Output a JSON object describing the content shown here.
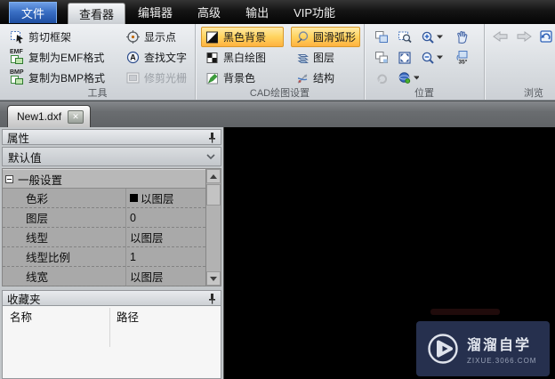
{
  "menubar": {
    "items": [
      {
        "label": "文件"
      },
      {
        "label": "查看器"
      },
      {
        "label": "编辑器"
      },
      {
        "label": "高级"
      },
      {
        "label": "输出"
      },
      {
        "label": "VIP功能"
      }
    ]
  },
  "ribbon": {
    "groups": [
      {
        "label": "工具",
        "buttons": [
          {
            "label": "剪切框架",
            "icon": "cut-frame-icon"
          },
          {
            "label": "复制为EMF格式",
            "icon": "copy-emf-icon",
            "icon_text": "EMF"
          },
          {
            "label": "复制为BMP格式",
            "icon": "copy-bmp-icon",
            "icon_text": "BMP"
          },
          {
            "label": "显示点",
            "icon": "show-point-icon"
          },
          {
            "label": "查找文字",
            "icon": "find-text-icon",
            "icon_glyph": "A"
          },
          {
            "label": "修剪光栅",
            "icon": "trim-raster-icon",
            "disabled": true
          }
        ]
      },
      {
        "label": "CAD绘图设置",
        "buttons": [
          {
            "label": "黑色背景",
            "icon": "black-background-icon",
            "active": true
          },
          {
            "label": "黑白绘图",
            "icon": "bw-drawing-icon"
          },
          {
            "label": "背景色",
            "icon": "background-color-icon"
          },
          {
            "label": "圆滑弧形",
            "icon": "smooth-arc-icon",
            "active": true
          },
          {
            "label": "图层",
            "icon": "layers-icon"
          },
          {
            "label": "结构",
            "icon": "structure-icon"
          }
        ]
      },
      {
        "label": "位置",
        "rotate_angle_label": "35°",
        "icons": [
          "pages-icon",
          "zoom-window-icon",
          "zoom-in-icon",
          "pan-hand-icon",
          "pages-alt-icon",
          "fit-screen-icon",
          "zoom-out-icon",
          "rotate-angle-icon",
          "rotate-icon",
          "orbit-view-icon"
        ]
      },
      {
        "label": "浏览",
        "icons": [
          "back-arrow-icon",
          "forward-arrow-icon",
          "undo-view-icon",
          "refresh-icon"
        ]
      }
    ]
  },
  "tabbar": {
    "tabs": [
      {
        "label": "New1.dxf",
        "close_glyph": "✕"
      }
    ]
  },
  "properties_panel": {
    "title": "属性",
    "preset_value": "默认值",
    "section": "一般设置",
    "rows": [
      {
        "label": "色彩",
        "value": "以图层",
        "swatch": "#000000"
      },
      {
        "label": "图层",
        "value": "0"
      },
      {
        "label": "线型",
        "value": "以图层"
      },
      {
        "label": "线型比例",
        "value": "1"
      },
      {
        "label": "线宽",
        "value": "以图层"
      }
    ]
  },
  "favorites_panel": {
    "title": "收藏夹",
    "columns": [
      {
        "label": "名称"
      },
      {
        "label": "路径"
      }
    ]
  },
  "canvas": {
    "watermark": {
      "title": "溜溜自学",
      "url": "ZIXUE.3066.COM"
    }
  },
  "colors": {
    "active_toggle_orange": "#ffd35e",
    "file_button_blue": "#3a6fc4",
    "canvas_black": "#000000",
    "watermark_navy": "#26304e",
    "ribbon_gray": "#dadee2"
  }
}
